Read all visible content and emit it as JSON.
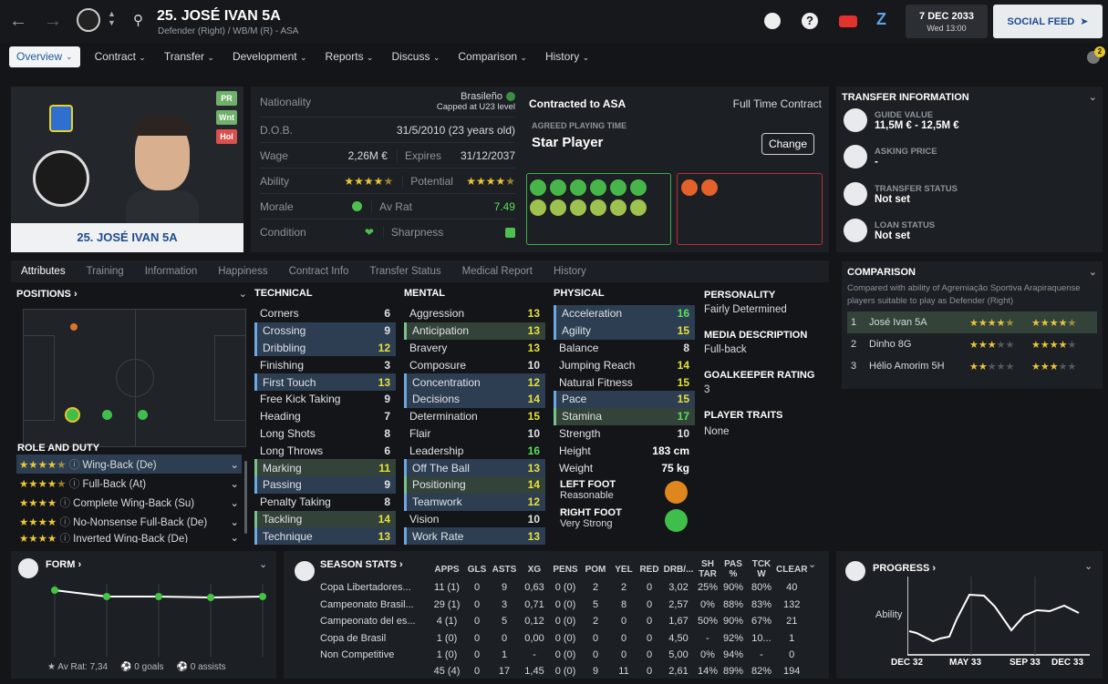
{
  "header": {
    "title": "25. JOSÉ IVAN 5A",
    "subtitle": "Defender (Right) / WB/M (R) - ASA",
    "date": "7 DEC 2033",
    "time": "Wed 13:00",
    "social_feed": "SOCIAL FEED",
    "notif_count": "2"
  },
  "menu": [
    {
      "label": "Overview"
    },
    {
      "label": "Contract"
    },
    {
      "label": "Transfer"
    },
    {
      "label": "Development"
    },
    {
      "label": "Reports"
    },
    {
      "label": "Discuss"
    },
    {
      "label": "Comparison"
    },
    {
      "label": "History"
    }
  ],
  "player": {
    "name": "25. JOSÉ IVAN 5A",
    "badges": [
      "PR",
      "Wnt",
      "Hol"
    ]
  },
  "overview": {
    "nationality_label": "Nationality",
    "nationality": "Brasileño",
    "nationality_note": "Capped at U23 level",
    "dob_label": "D.O.B.",
    "dob": "31/5/2010 (23 years old)",
    "wage_label": "Wage",
    "wage": "2,26M €",
    "expires_label": "Expires",
    "expires": "31/12/2037",
    "ability_label": "Ability",
    "potential_label": "Potential",
    "morale_label": "Morale",
    "avrat_label": "Av Rat",
    "avrat": "7.49",
    "condition_label": "Condition",
    "sharpness_label": "Sharpness"
  },
  "contract": {
    "title": "Contracted to ASA",
    "type": "Full Time Contract",
    "apt_label": "AGREED PLAYING TIME",
    "apt": "Star Player",
    "change": "Change"
  },
  "transfer_info": {
    "title": "TRANSFER INFORMATION",
    "items": [
      {
        "label": "GUIDE VALUE",
        "value": "11,5M € - 12,5M €"
      },
      {
        "label": "ASKING PRICE",
        "value": "-"
      },
      {
        "label": "TRANSFER STATUS",
        "value": "Not set"
      },
      {
        "label": "LOAN STATUS",
        "value": "Not set"
      }
    ]
  },
  "subtabs": [
    "Attributes",
    "Training",
    "Information",
    "Happiness",
    "Contract Info",
    "Transfer Status",
    "Medical Report",
    "History"
  ],
  "positions_title": "POSITIONS",
  "role_title": "ROLE AND DUTY",
  "roles": [
    "Wing-Back (De)",
    "Full-Back (At)",
    "Complete Wing-Back (Su)",
    "No-Nonsense Full-Back (De)",
    "Inverted Wing-Back (De)"
  ],
  "technical": {
    "title": "TECHNICAL",
    "rows": [
      [
        "Corners",
        "6"
      ],
      [
        "Crossing",
        "9"
      ],
      [
        "Dribbling",
        "12"
      ],
      [
        "Finishing",
        "3"
      ],
      [
        "First Touch",
        "13"
      ],
      [
        "Free Kick Taking",
        "9"
      ],
      [
        "Heading",
        "7"
      ],
      [
        "Long Shots",
        "8"
      ],
      [
        "Long Throws",
        "6"
      ],
      [
        "Marking",
        "11"
      ],
      [
        "Passing",
        "9"
      ],
      [
        "Penalty Taking",
        "8"
      ],
      [
        "Tackling",
        "14"
      ],
      [
        "Technique",
        "13"
      ]
    ]
  },
  "mental": {
    "title": "MENTAL",
    "rows": [
      [
        "Aggression",
        "13"
      ],
      [
        "Anticipation",
        "13"
      ],
      [
        "Bravery",
        "13"
      ],
      [
        "Composure",
        "10"
      ],
      [
        "Concentration",
        "12"
      ],
      [
        "Decisions",
        "14"
      ],
      [
        "Determination",
        "15"
      ],
      [
        "Flair",
        "10"
      ],
      [
        "Leadership",
        "16"
      ],
      [
        "Off The Ball",
        "13"
      ],
      [
        "Positioning",
        "14"
      ],
      [
        "Teamwork",
        "12"
      ],
      [
        "Vision",
        "10"
      ],
      [
        "Work Rate",
        "13"
      ]
    ]
  },
  "physical": {
    "title": "PHYSICAL",
    "rows": [
      [
        "Acceleration",
        "16"
      ],
      [
        "Agility",
        "15"
      ],
      [
        "Balance",
        "8"
      ],
      [
        "Jumping Reach",
        "14"
      ],
      [
        "Natural Fitness",
        "15"
      ],
      [
        "Pace",
        "15"
      ],
      [
        "Stamina",
        "17"
      ],
      [
        "Strength",
        "10"
      ],
      [
        "Height",
        "183 cm"
      ],
      [
        "Weight",
        "75 kg"
      ]
    ],
    "left_foot_label": "LEFT FOOT",
    "left_foot": "Reasonable",
    "right_foot_label": "RIGHT FOOT",
    "right_foot": "Very Strong"
  },
  "personality": {
    "title": "PERSONALITY",
    "value": "Fairly Determined",
    "media_title": "MEDIA DESCRIPTION",
    "media": "Full-back",
    "gk_title": "GOALKEEPER RATING",
    "gk": "3",
    "traits_title": "PLAYER TRAITS",
    "traits": "None"
  },
  "comparison": {
    "title": "COMPARISON",
    "desc": "Compared with ability of Agremiação Sportiva Arapiraquense players suitable to play as Defender (Right)",
    "rows": [
      {
        "rank": "1",
        "name": "José Ivan 5A"
      },
      {
        "rank": "2",
        "name": "Dinho 8G"
      },
      {
        "rank": "3",
        "name": "Hélio Amorim 5H"
      }
    ]
  },
  "form": {
    "title": "FORM",
    "av_rat": "Av Rat: 7,34",
    "goals": "0 goals",
    "assists": "0 assists"
  },
  "season": {
    "title": "SEASON STATS",
    "headers": [
      "APPS",
      "GLS",
      "ASTS",
      "XG",
      "PENS",
      "POM",
      "YEL",
      "RED",
      "DRB/...",
      "SH TAR",
      "PAS %",
      "TCK W",
      "CLEAR"
    ],
    "rows": [
      {
        "comp": "Copa Libertadores...",
        "vals": [
          "11 (1)",
          "0",
          "9",
          "0,63",
          "0 (0)",
          "2",
          "2",
          "0",
          "3,02",
          "25%",
          "90%",
          "80%",
          "40"
        ]
      },
      {
        "comp": "Campeonato Brasil...",
        "vals": [
          "29 (1)",
          "0",
          "3",
          "0,71",
          "0 (0)",
          "5",
          "8",
          "0",
          "2,57",
          "0%",
          "88%",
          "83%",
          "132"
        ]
      },
      {
        "comp": "Campeonato del es...",
        "vals": [
          "4 (1)",
          "0",
          "5",
          "0,12",
          "0 (0)",
          "2",
          "0",
          "0",
          "1,67",
          "50%",
          "90%",
          "67%",
          "21"
        ]
      },
      {
        "comp": "Copa de Brasil",
        "vals": [
          "1 (0)",
          "0",
          "0",
          "0,00",
          "0 (0)",
          "0",
          "0",
          "0",
          "4,50",
          "-",
          "92%",
          "10...",
          "1"
        ]
      },
      {
        "comp": "Non Competitive",
        "vals": [
          "1 (0)",
          "0",
          "1",
          "-",
          "0 (0)",
          "0",
          "0",
          "0",
          "5,00",
          "0%",
          "94%",
          "-",
          "0"
        ]
      }
    ],
    "totals": [
      "45 (4)",
      "0",
      "17",
      "1,45",
      "0 (0)",
      "9",
      "11",
      "0",
      "2,61",
      "14%",
      "89%",
      "82%",
      "194"
    ]
  },
  "progress": {
    "title": "PROGRESS",
    "ylabel": "Ability",
    "xlabels": [
      "DEC 32",
      "MAY 33",
      "SEP 33",
      "DEC 33"
    ]
  },
  "colors": {
    "accent": "#e6e13c",
    "good": "#5be05b",
    "bg": "#131518",
    "panel": "#1c1f23"
  }
}
